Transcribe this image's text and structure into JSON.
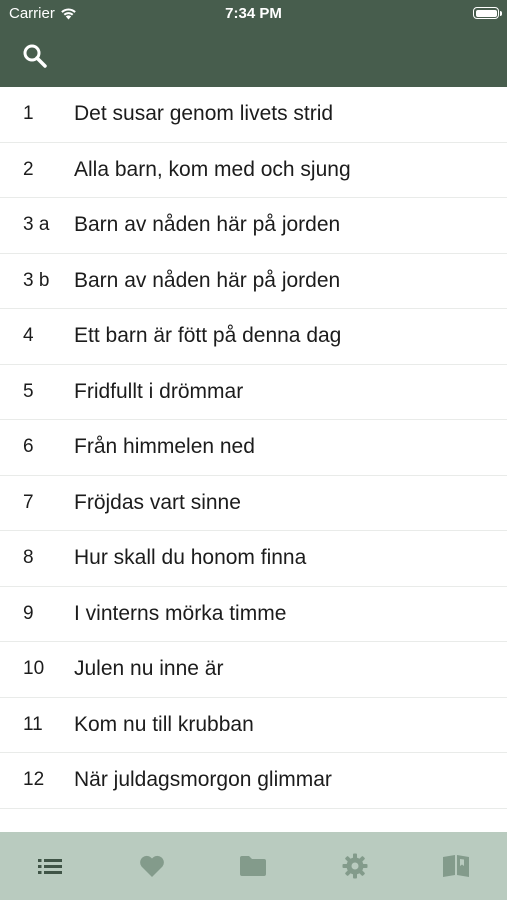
{
  "status_bar": {
    "carrier": "Carrier",
    "time": "7:34 PM"
  },
  "colors": {
    "header_bg": "#475d4d",
    "tabbar_bg": "#b9cbbf",
    "tab_active": "#3f5446",
    "tab_inactive": "#839b8b"
  },
  "header": {
    "search_icon": "search-icon"
  },
  "songs": [
    {
      "num": "1",
      "title": "Det susar genom livets strid"
    },
    {
      "num": "2",
      "title": "Alla barn, kom med och sjung"
    },
    {
      "num": "3 a",
      "title": "Barn av nåden här på jorden"
    },
    {
      "num": "3 b",
      "title": "Barn av nåden här på jorden"
    },
    {
      "num": "4",
      "title": "Ett barn är fött på denna dag"
    },
    {
      "num": "5",
      "title": "Fridfullt i drömmar"
    },
    {
      "num": "6",
      "title": "Från himmelen ned"
    },
    {
      "num": "7",
      "title": "Fröjdas vart sinne"
    },
    {
      "num": "8",
      "title": "Hur skall du honom finna"
    },
    {
      "num": "9",
      "title": "I vinterns mörka timme"
    },
    {
      "num": "10",
      "title": "Julen nu inne är"
    },
    {
      "num": "11",
      "title": "Kom nu till krubban"
    },
    {
      "num": "12",
      "title": "När juldagsmorgon glimmar"
    }
  ],
  "tabbar": {
    "tabs": [
      {
        "icon": "list-icon",
        "active": true
      },
      {
        "icon": "heart-icon",
        "active": false
      },
      {
        "icon": "folder-icon",
        "active": false
      },
      {
        "icon": "gear-icon",
        "active": false
      },
      {
        "icon": "book-icon",
        "active": false
      }
    ]
  }
}
